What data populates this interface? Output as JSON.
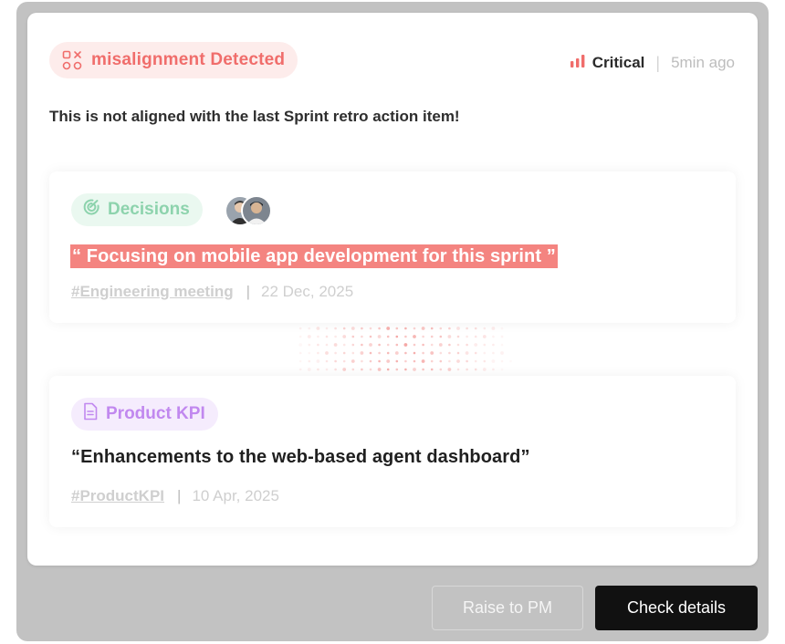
{
  "alert": {
    "badge_label": "misalignment Detected",
    "badge_icon": "shapes-x-icon",
    "severity_label": "Critical",
    "severity_icon": "signal-bars-icon",
    "time_ago": "5min ago",
    "message": "This is not aligned with the last Sprint retro action item!"
  },
  "decision_card": {
    "tag_label": "Decisions",
    "tag_icon": "target-check-icon",
    "quote": "“ Focusing on mobile app development for this sprint ”",
    "source": "#Engineering meeting",
    "separator": "|",
    "date": "22 Dec, 2025"
  },
  "kpi_card": {
    "tag_label": "Product KPI",
    "tag_icon": "document-icon",
    "quote": "“Enhancements to the web-based agent dashboard”",
    "source": "#ProductKPI",
    "separator": "|",
    "date": "10 Apr, 2025"
  },
  "actions": {
    "raise_label": "Raise to PM",
    "check_label": "Check details"
  },
  "colors": {
    "critical": "#f06d6b",
    "highlight": "#f48480",
    "decision_green": "#8dd3ad",
    "kpi_purple": "#c188ef",
    "primary_button": "#111111"
  }
}
